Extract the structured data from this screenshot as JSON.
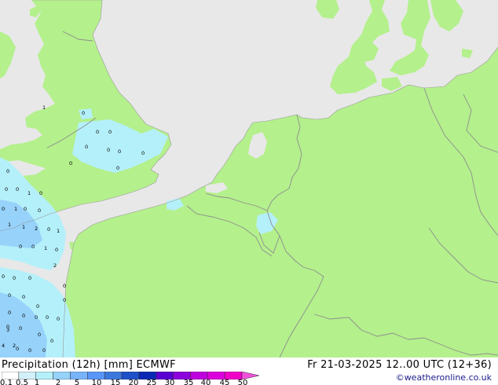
{
  "map": {
    "product": "Precipitation (12h) [mm] ECMWF",
    "valid_time": "Fr 21-03-2025 12..00 UTC (12+36)",
    "credit": "©weatheronline.co.uk",
    "colors": {
      "sea": "#e8e8e8",
      "land": "#b4f08c",
      "borders": "#8e8e8e",
      "coast": "#999999",
      "precip_light": "#b4f0fa",
      "precip_medium": "#96d2fa"
    },
    "legend": {
      "labels": [
        "0.1",
        "0.5",
        "1",
        "2",
        "5",
        "10",
        "15",
        "20",
        "25",
        "30",
        "35",
        "40",
        "45",
        "50"
      ],
      "colors": [
        "#ffffff",
        "#d2f0fa",
        "#b4f0fa",
        "#96d2fa",
        "#78b4fa",
        "#5a96fa",
        "#3c78dc",
        "#1e50c8",
        "#0a28b4",
        "#5a00d2",
        "#8c00dc",
        "#be00dc",
        "#dc00dc",
        "#f000c8",
        "#f050dc"
      ]
    },
    "values": [
      {
        "t": "0"
      },
      {
        "t": "0"
      },
      {
        "t": "0"
      },
      {
        "t": "0"
      },
      {
        "t": "0"
      },
      {
        "t": "0"
      },
      {
        "t": "1"
      },
      {
        "t": "0"
      },
      {
        "t": "0"
      },
      {
        "t": "0"
      },
      {
        "t": "0"
      },
      {
        "t": "0"
      },
      {
        "t": "0"
      },
      {
        "t": "1"
      },
      {
        "t": "0"
      },
      {
        "t": "0"
      },
      {
        "t": "1"
      },
      {
        "t": "0"
      },
      {
        "t": "0"
      },
      {
        "t": "1"
      },
      {
        "t": "1"
      },
      {
        "t": "2"
      },
      {
        "t": "0"
      },
      {
        "t": "1"
      },
      {
        "t": "0"
      },
      {
        "t": "0"
      },
      {
        "t": "1"
      },
      {
        "t": "0"
      },
      {
        "t": "2"
      },
      {
        "t": "0"
      },
      {
        "t": "0"
      },
      {
        "t": "0"
      },
      {
        "t": "0"
      },
      {
        "t": "0"
      },
      {
        "t": "0"
      },
      {
        "t": "0"
      },
      {
        "t": "0"
      },
      {
        "t": "0"
      },
      {
        "t": "0"
      },
      {
        "t": "0"
      },
      {
        "t": "0"
      },
      {
        "t": "0"
      },
      {
        "t": "0"
      },
      {
        "t": "0"
      },
      {
        "t": "3"
      },
      {
        "t": "0"
      },
      {
        "t": "0"
      },
      {
        "t": "2"
      },
      {
        "t": "4"
      },
      {
        "t": "0"
      },
      {
        "t": "0"
      },
      {
        "t": "0"
      }
    ]
  }
}
